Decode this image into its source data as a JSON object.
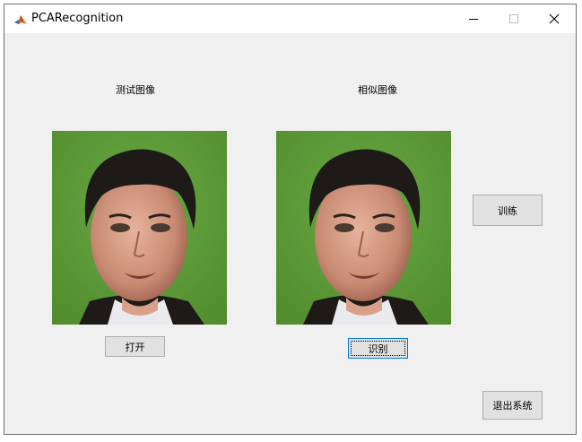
{
  "window": {
    "title": "PCARecognition"
  },
  "labels": {
    "test_image": "测试图像",
    "similar_image": "相似图像"
  },
  "buttons": {
    "open": "打开",
    "recognize": "识别",
    "train": "训练",
    "exit": "退出系统"
  },
  "colors": {
    "photo_background": "#5f9e3a",
    "button_face": "#e1e1e1",
    "focus_border": "#0078d7"
  },
  "icons": {
    "app": "matlab-icon",
    "minimize": "minimize-icon",
    "maximize": "maximize-icon",
    "close": "close-icon"
  }
}
